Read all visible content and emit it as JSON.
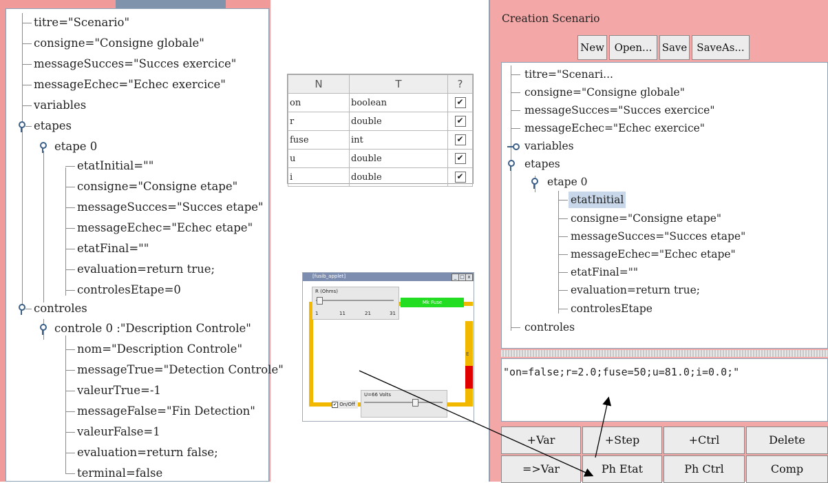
{
  "left_tree": {
    "nodes": [
      {
        "text": "titre=\"Scenario\""
      },
      {
        "text": "consigne=\"Consigne globale\""
      },
      {
        "text": "messageSucces=\"Succes exercice\""
      },
      {
        "text": "messageEchec=\"Echec exercice\""
      },
      {
        "text": "variables"
      },
      {
        "text": "etapes"
      },
      {
        "text": "etape 0"
      },
      {
        "text": "etatInitial=\"\""
      },
      {
        "text": "consigne=\"Consigne etape\""
      },
      {
        "text": "messageSucces=\"Succes etape\""
      },
      {
        "text": "messageEchec=\"Echec etape\""
      },
      {
        "text": "etatFinal=\"\""
      },
      {
        "text": "evaluation=return true;"
      },
      {
        "text": "controlesEtape=0"
      },
      {
        "text": "controles"
      },
      {
        "text": "controle 0 :\"Description Controle\""
      },
      {
        "text": "nom=\"Description Controle\""
      },
      {
        "text": "messageTrue=\"Detection Controle\""
      },
      {
        "text": "valeurTrue=-1"
      },
      {
        "text": "messageFalse=\"Fin Detection\""
      },
      {
        "text": "valeurFalse=1"
      },
      {
        "text": "evaluation=return false;"
      },
      {
        "text": "terminal=false"
      }
    ]
  },
  "var_table": {
    "headers": [
      "N",
      "T",
      "?"
    ],
    "rows": [
      {
        "n": "on",
        "t": "boolean",
        "check": "✔"
      },
      {
        "n": "r",
        "t": "double",
        "check": "✔"
      },
      {
        "n": "fuse",
        "t": "int",
        "check": "✔"
      },
      {
        "n": "u",
        "t": "double",
        "check": "✔"
      },
      {
        "n": "i",
        "t": "double",
        "check": "✔"
      }
    ]
  },
  "applet": {
    "title": "[fusib_applet]",
    "r_label": "R (Ohms)",
    "r_ticks": [
      "1",
      "11",
      "21",
      "31"
    ],
    "green_label": "Mk Fuse",
    "fuse_label": "E",
    "u_label": "U=66 Volts",
    "onoff_label": "On/Off",
    "win_buttons": [
      "_",
      "□",
      "x"
    ]
  },
  "right_panel": {
    "title": "Creation Scenario",
    "toolbar": [
      "New",
      "Open...",
      "Save",
      "SaveAs..."
    ],
    "tree": [
      {
        "text": "titre=\"Scenari..."
      },
      {
        "text": "consigne=\"Consigne globale\""
      },
      {
        "text": "messageSucces=\"Succes exercice\""
      },
      {
        "text": "messageEchec=\"Echec exercice\""
      },
      {
        "text": "variables"
      },
      {
        "text": "etapes"
      },
      {
        "text": "etape 0"
      },
      {
        "text": "etatInitial"
      },
      {
        "text": "consigne=\"Consigne etape\""
      },
      {
        "text": "messageSucces=\"Succes etape\""
      },
      {
        "text": "messageEchec=\"Echec etape\""
      },
      {
        "text": "etatFinal=\"\""
      },
      {
        "text": "evaluation=return true;"
      },
      {
        "text": "controlesEtape"
      },
      {
        "text": "controles"
      }
    ],
    "state_text": "\"on=false;r=2.0;fuse=50;u=81.0;i=0.0;\"",
    "buttons_row1": [
      "+Var",
      "+Step",
      "+Ctrl",
      "Delete"
    ],
    "buttons_row2": [
      "=>Var",
      "Ph Etat",
      "Ph Ctrl",
      "Comp"
    ]
  },
  "colors": {
    "panel_pink": "#f4a7a7",
    "fuse_green": "#22dd22",
    "wire_orange": "#f2b800",
    "fuse_red": "#e00000"
  }
}
